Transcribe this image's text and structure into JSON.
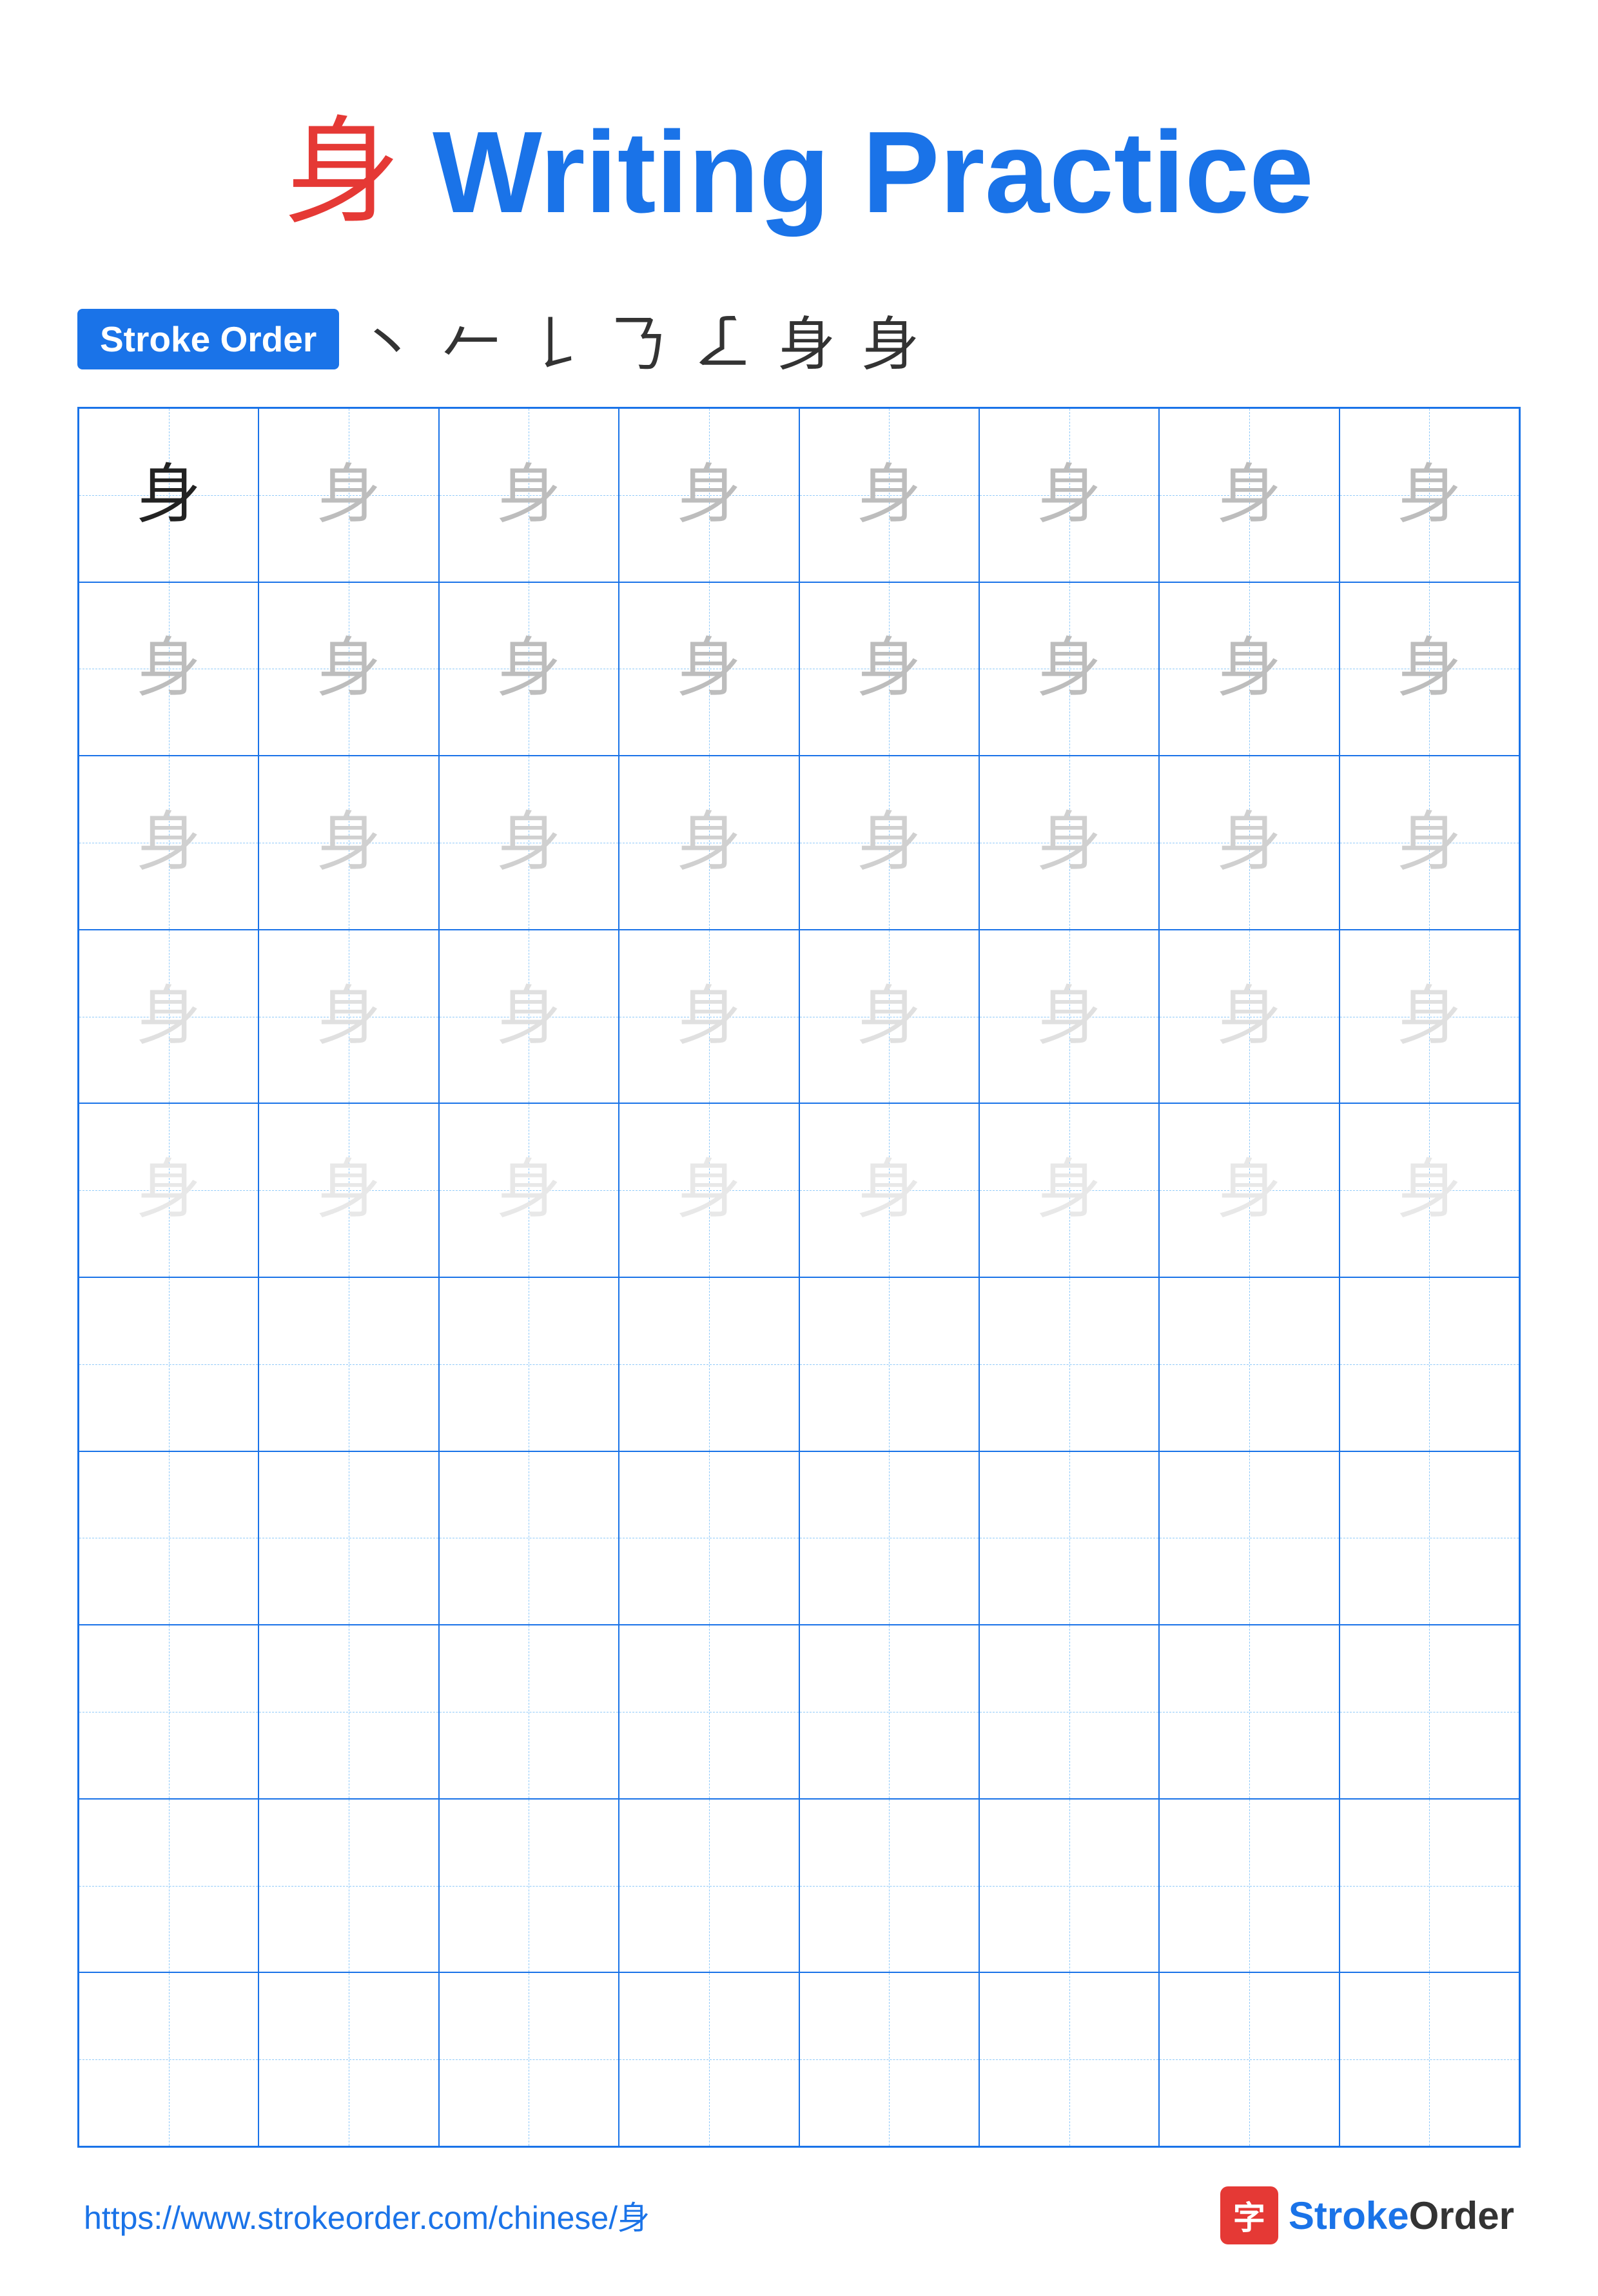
{
  "title": {
    "char": "身",
    "text": " Writing Practice"
  },
  "stroke_order": {
    "badge_label": "Stroke Order",
    "strokes": [
      "丶",
      "𠂉",
      "𠄌",
      "𠄎",
      "𠄏",
      "身",
      "身"
    ]
  },
  "grid": {
    "rows": 10,
    "cols": 8,
    "char": "身",
    "filled_rows": 5,
    "opacity_levels": [
      "dark",
      "light-1",
      "light-1",
      "light-2",
      "light-3"
    ]
  },
  "footer": {
    "url": "https://www.strokeorder.com/chinese/身",
    "logo_char": "字",
    "logo_text_stroke": "Stroke",
    "logo_text_order": "Order"
  }
}
